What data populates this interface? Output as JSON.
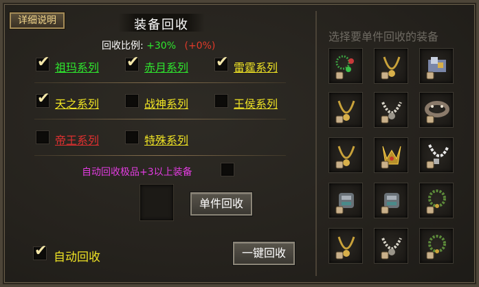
{
  "header": {
    "detail_button": "详细说明",
    "title": "装备回收"
  },
  "ratio": {
    "label": "回收比例:",
    "value": "+30%",
    "bonus": "(+0%)"
  },
  "series": [
    {
      "label": "祖玛系列",
      "checked": true,
      "color": "green"
    },
    {
      "label": "赤月系列",
      "checked": true,
      "color": "green"
    },
    {
      "label": "雷霆系列",
      "checked": true,
      "color": "yellow"
    },
    {
      "label": "天之系列",
      "checked": true,
      "color": "yellow"
    },
    {
      "label": "战神系列",
      "checked": false,
      "color": "yellow"
    },
    {
      "label": "王侯系列",
      "checked": false,
      "color": "yellow"
    },
    {
      "label": "帝王系列",
      "checked": false,
      "color": "red"
    },
    {
      "label": "特殊系列",
      "checked": false,
      "color": "yellow"
    }
  ],
  "auto_high": {
    "label": "自动回收极品+3以上装备",
    "checked": false
  },
  "buttons": {
    "single": "单件回收",
    "onekey": "一键回收"
  },
  "auto_recycle": {
    "label": "自动回收",
    "checked": true
  },
  "right": {
    "title": "选择要单件回收的装备",
    "items": [
      "bracelet-beads-icon",
      "necklace-gold-icon",
      "gem-pile-icon",
      "necklace-gold-icon",
      "necklace-skull-icon",
      "belt-studded-icon",
      "necklace-gold-icon",
      "crown-horned-icon",
      "necklace-chain-icon",
      "bracer-armor-icon",
      "bracer-armor-icon",
      "bracelet-jade-icon",
      "necklace-gold-icon",
      "necklace-skull-icon",
      "bracelet-jade-icon"
    ]
  }
}
